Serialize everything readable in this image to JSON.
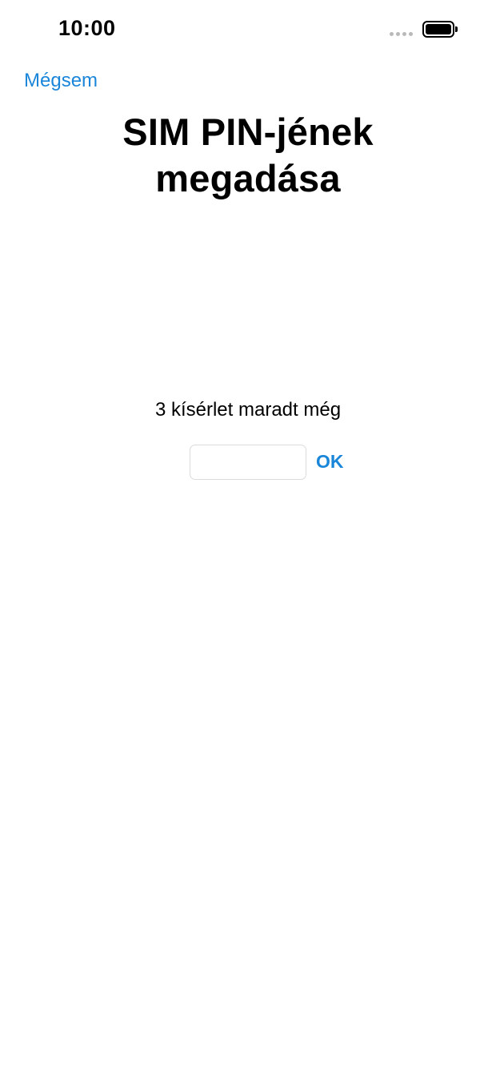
{
  "status_bar": {
    "time": "10:00",
    "signal_icon": "signal-dots-icon",
    "battery_icon": "battery-full-icon"
  },
  "nav": {
    "cancel_label": "Mégsem"
  },
  "title": "SIM PIN-jének megadása",
  "attempts_text": "3 kísérlet maradt még",
  "pin_input": {
    "value": "",
    "placeholder": ""
  },
  "ok_label": "OK",
  "colors": {
    "accent": "#1a86d9",
    "background": "#ffffff",
    "text": "#000000"
  }
}
